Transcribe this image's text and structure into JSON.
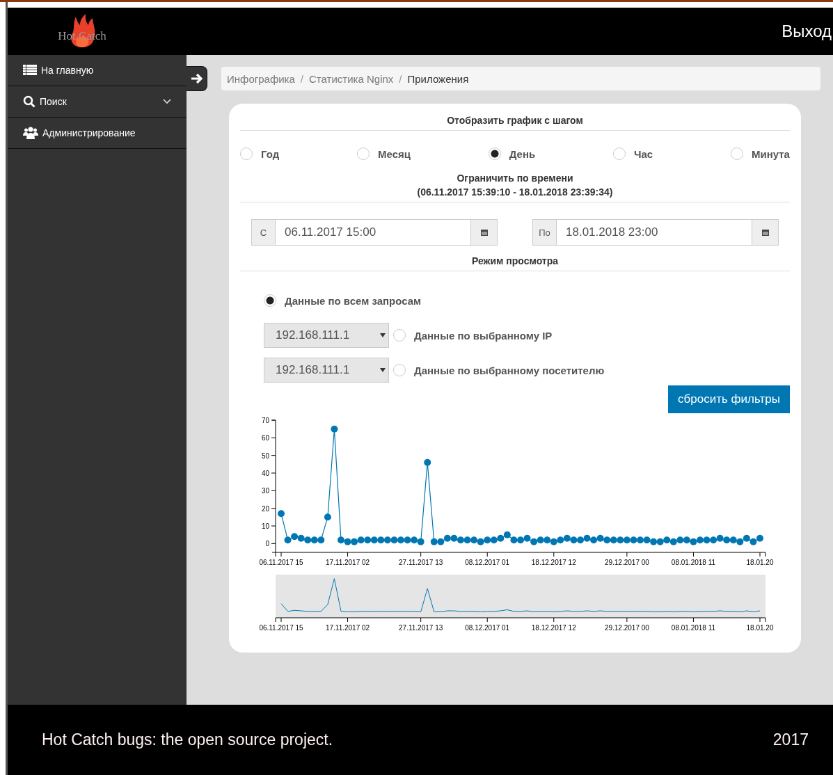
{
  "header": {
    "logo": "Hot Catch",
    "logout": "Выход"
  },
  "sidebar": {
    "items": [
      {
        "label": "На главную",
        "kind": "list",
        "expandable": false
      },
      {
        "label": "Поиск",
        "kind": "search",
        "expandable": true
      },
      {
        "label": "Администрирование",
        "kind": "users",
        "expandable": false
      }
    ]
  },
  "breadcrumb": {
    "separator": "/",
    "items": [
      {
        "label": "Инфографика",
        "current": false
      },
      {
        "label": "Статистика Nginx",
        "current": false
      },
      {
        "label": "Приложения",
        "current": true
      }
    ]
  },
  "step": {
    "title": "Отобразить график с шагом",
    "options": [
      {
        "label": "Год",
        "selected": false
      },
      {
        "label": "Месяц",
        "selected": false
      },
      {
        "label": "День",
        "selected": true
      },
      {
        "label": "Час",
        "selected": false
      },
      {
        "label": "Минута",
        "selected": false
      }
    ]
  },
  "time_limit": {
    "title": "Ограничить по времени",
    "range": "(06.11.2017 15:39:10 - 18.01.2018 23:39:34)",
    "from": {
      "addon": "С",
      "value": "06.11.2017 15:00"
    },
    "to": {
      "addon": "По",
      "value": "18.01.2018 23:00"
    }
  },
  "view_mode": {
    "title": "Режим просмотра",
    "options": [
      {
        "kind": "radio",
        "label": "Данные по всем запросам",
        "selected": true
      },
      {
        "kind": "select",
        "select_value": "192.168.111.1",
        "label": "Данные по выбранному IP",
        "selected": false
      },
      {
        "kind": "select",
        "select_value": "192.168.111.1",
        "label": "Данные по выбранному посетителю",
        "selected": false
      }
    ],
    "reset_button": "сбросить фильтры"
  },
  "chart_data": {
    "type": "line",
    "ylim": [
      -5,
      70
    ],
    "yticks": [
      0,
      10,
      20,
      30,
      40,
      50,
      60,
      70
    ],
    "categories": [
      "06.11.2017 15",
      null,
      null,
      null,
      null,
      null,
      null,
      null,
      null,
      null,
      "17.11.2017 02",
      null,
      null,
      null,
      null,
      null,
      null,
      null,
      null,
      null,
      null,
      "27.11.2017 13",
      null,
      null,
      null,
      null,
      null,
      null,
      null,
      null,
      null,
      "08.12.2017 01",
      null,
      null,
      null,
      null,
      null,
      null,
      null,
      null,
      null,
      "18.12.2017 12",
      null,
      null,
      null,
      null,
      null,
      null,
      null,
      null,
      null,
      null,
      "29.12.2017 00",
      null,
      null,
      null,
      null,
      null,
      null,
      null,
      null,
      null,
      "08.01.2018 11",
      null,
      null,
      null,
      null,
      null,
      null,
      null,
      null,
      null,
      "18.01.20"
    ],
    "series": [
      {
        "color": "#0077b3",
        "marker": "o",
        "values": [
          17,
          2,
          4,
          3,
          2,
          2,
          2,
          15,
          65,
          2,
          1,
          1,
          2,
          2,
          2,
          2,
          2,
          2,
          2,
          2,
          2,
          1,
          46,
          1,
          1,
          3,
          3,
          2,
          2,
          2,
          1,
          2,
          2,
          3,
          5,
          2,
          2,
          3,
          1,
          2,
          2,
          1,
          2,
          3,
          2,
          2,
          3,
          2,
          3,
          2,
          2,
          2,
          2,
          2,
          2,
          2,
          1,
          1,
          2,
          1,
          2,
          2,
          1,
          2,
          2,
          2,
          3,
          2,
          2,
          1,
          3,
          1,
          3
        ]
      }
    ]
  },
  "overview": {
    "xtick_labels": [
      "06.11.2017 15",
      "17.11.2017 02",
      "27.11.2017 13",
      "08.12.2017 01",
      "18.12.2017 12",
      "29.12.2017 00",
      "08.01.2018 11",
      "18.01.20"
    ]
  },
  "footer": {
    "text": "Hot Catch bugs: the open source project.",
    "year": "2017"
  }
}
